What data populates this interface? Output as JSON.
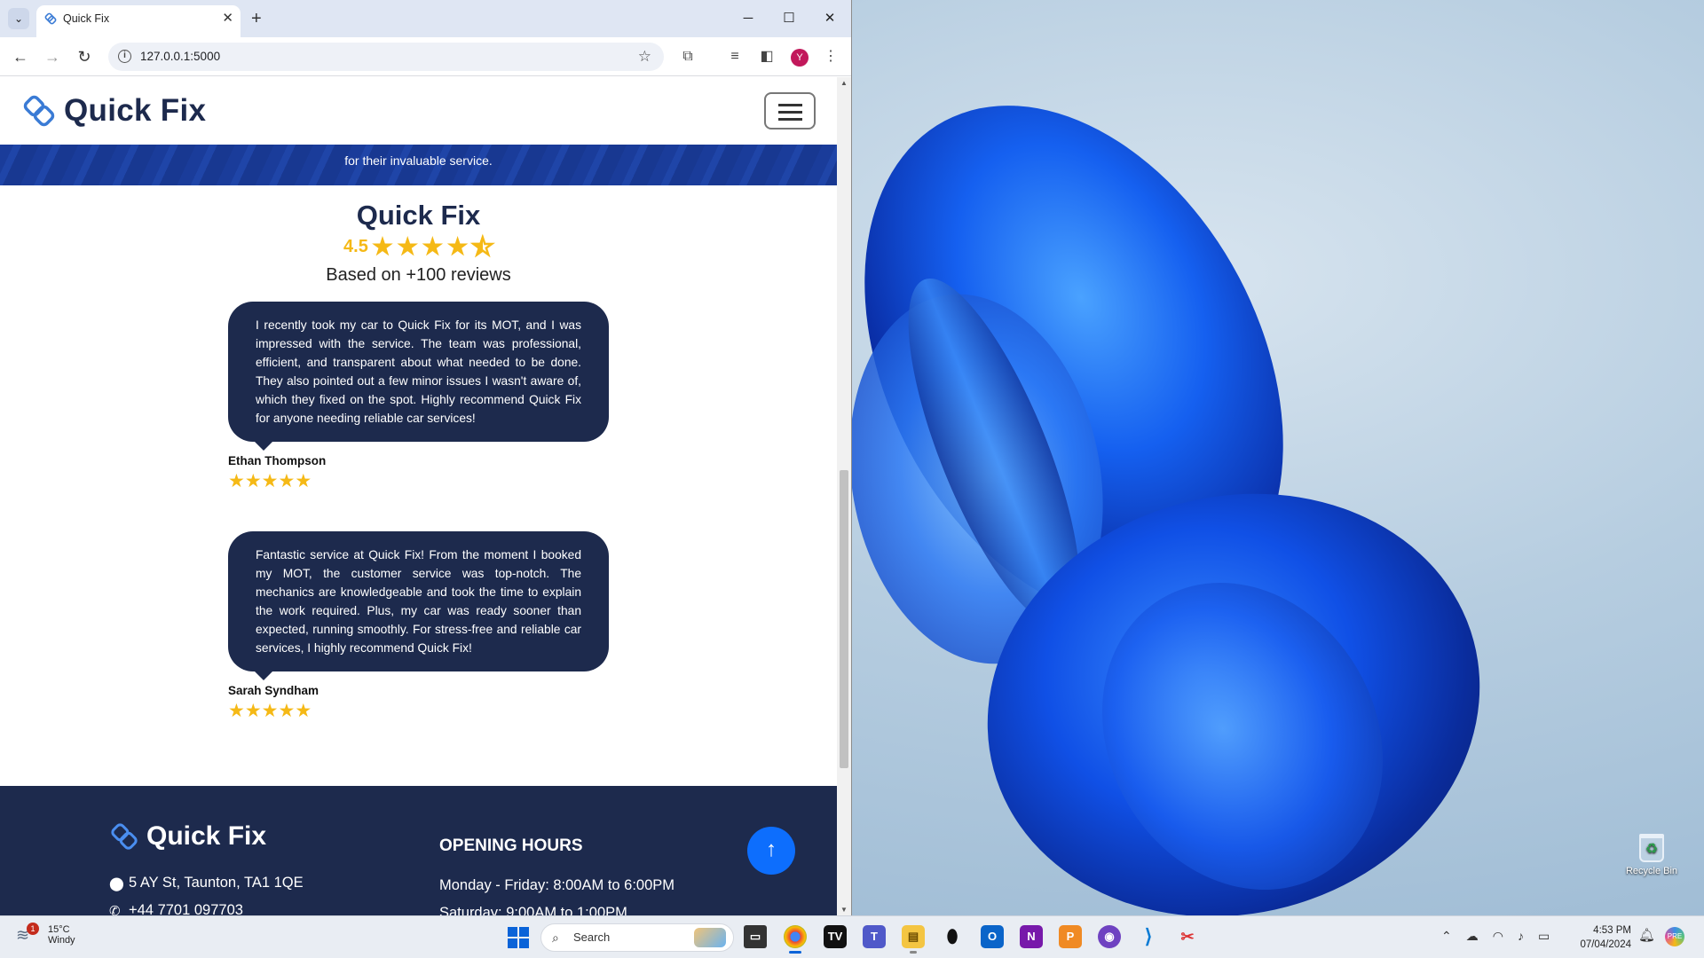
{
  "browser": {
    "tab_title": "Quick Fix",
    "url": "127.0.0.1:5000",
    "avatar_letter": "Y"
  },
  "site": {
    "logo_text": "Quick Fix",
    "banner_text": "for their invaluable service."
  },
  "rating": {
    "title": "Quick Fix",
    "score": "4.5",
    "stars": 4.5,
    "subtitle": "Based on +100 reviews"
  },
  "reviews": [
    {
      "text": "I recently took my car to Quick Fix for its MOT, and I was impressed with the service. The team was professional, efficient, and transparent about what needed to be done. They also pointed out a few minor issues I wasn't aware of, which they fixed on the spot. Highly recommend Quick Fix for anyone needing reliable car services!",
      "name": "Ethan Thompson",
      "stars": 5
    },
    {
      "text": "Fantastic service at Quick Fix! From the moment I booked my MOT, the customer service was top-notch. The mechanics are knowledgeable and took the time to explain the work required. Plus, my car was ready sooner than expected, running smoothly. For stress-free and reliable car services, I highly recommend Quick Fix!",
      "name": "Sarah Syndham",
      "stars": 5
    }
  ],
  "footer": {
    "logo_text": "Quick Fix",
    "address": "5 AY St, Taunton, TA1 1QE",
    "phone": "+44 7701 097703",
    "hours_title": "OPENING HOURS",
    "hours_weekday": "Monday - Friday: 8:00AM to 6:00PM",
    "hours_saturday": "Saturday: 9:00AM to 1:00PM"
  },
  "desktop": {
    "recycle_bin_label": "Recycle Bin"
  },
  "taskbar": {
    "weather_temp": "15°C",
    "weather_desc": "Windy",
    "weather_badge": "1",
    "search_placeholder": "Search",
    "time": "4:53 PM",
    "date": "07/04/2024"
  },
  "colors": {
    "brand_navy": "#1d2a4d",
    "star_gold": "#f5b916",
    "accent_blue": "#0d6efd"
  }
}
